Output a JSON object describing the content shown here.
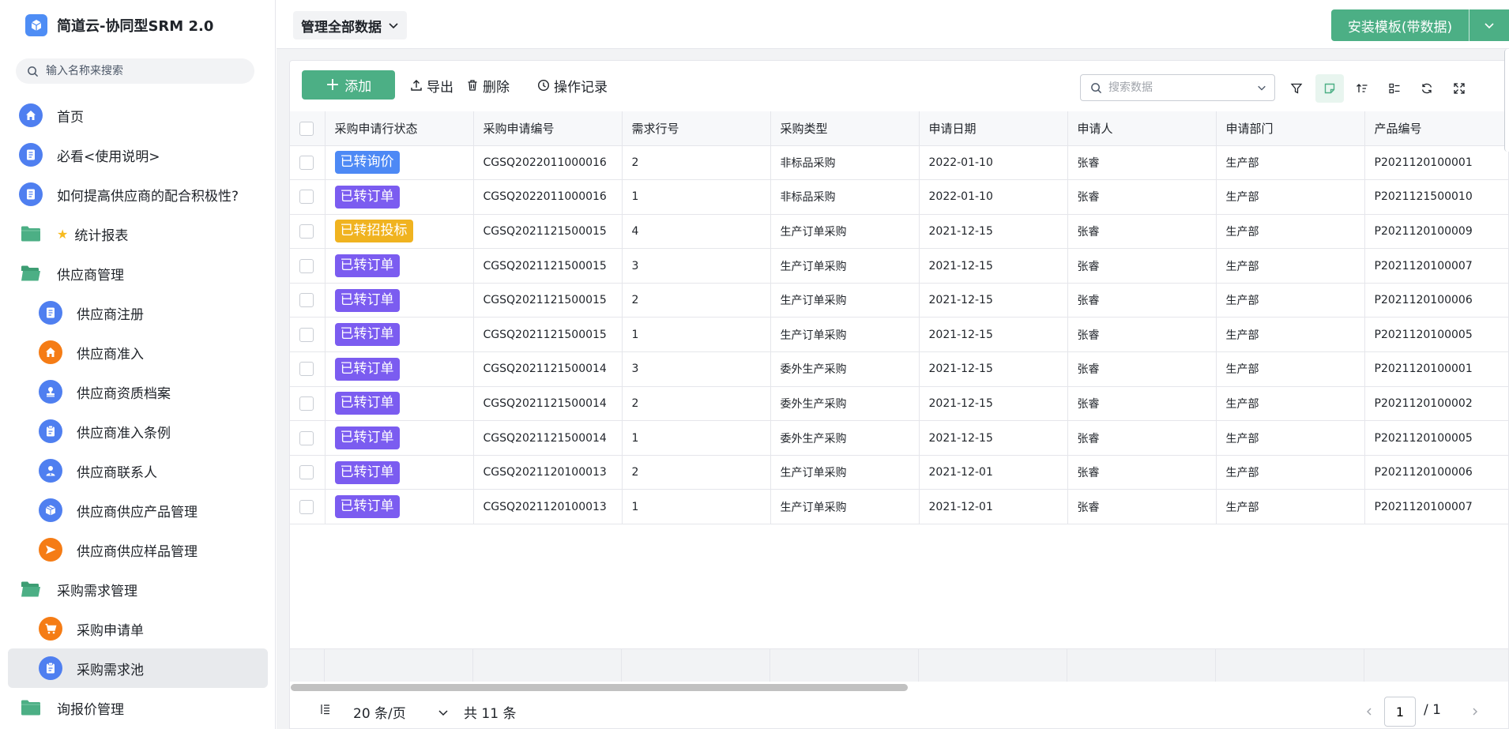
{
  "app": {
    "title": "简道云-协同型SRM 2.0"
  },
  "sidebar": {
    "search_placeholder": "输入名称来搜索",
    "items": [
      {
        "label": "首页",
        "icon": "home-icon",
        "level": 1,
        "color": "blue"
      },
      {
        "label": "必看<使用说明>",
        "icon": "document-icon",
        "level": 1,
        "color": "blue"
      },
      {
        "label": "如何提高供应商的配合积极性?",
        "icon": "document-icon",
        "level": 1,
        "color": "blue"
      },
      {
        "label": "统计报表",
        "icon": "folder-icon",
        "level": 1,
        "starred": true
      },
      {
        "label": "供应商管理",
        "icon": "folder-open-icon",
        "level": 1
      },
      {
        "label": "供应商注册",
        "icon": "document-icon",
        "level": 2,
        "color": "blue"
      },
      {
        "label": "供应商准入",
        "icon": "home-icon",
        "level": 2,
        "color": "orange"
      },
      {
        "label": "供应商资质档案",
        "icon": "stamp-icon",
        "level": 2,
        "color": "blue"
      },
      {
        "label": "供应商准入条例",
        "icon": "clipboard-icon",
        "level": 2,
        "color": "blue"
      },
      {
        "label": "供应商联系人",
        "icon": "user-icon",
        "level": 2,
        "color": "blue"
      },
      {
        "label": "供应商供应产品管理",
        "icon": "box-icon",
        "level": 2,
        "color": "blue"
      },
      {
        "label": "供应商供应样品管理",
        "icon": "send-icon",
        "level": 2,
        "color": "orange"
      },
      {
        "label": "采购需求管理",
        "icon": "folder-open-icon",
        "level": 1
      },
      {
        "label": "采购申请单",
        "icon": "cart-icon",
        "level": 2,
        "color": "orange"
      },
      {
        "label": "采购需求池",
        "icon": "clipboard-icon",
        "level": 2,
        "color": "blue",
        "active": true
      },
      {
        "label": "询报价管理",
        "icon": "folder-icon",
        "level": 1
      }
    ]
  },
  "topbar": {
    "scope_label": "管理全部数据",
    "install_label": "安装模板(带数据)"
  },
  "toolbar": {
    "add_label": "添加",
    "export_label": "导出",
    "delete_label": "删除",
    "log_label": "操作记录",
    "search_placeholder": "搜索数据"
  },
  "table": {
    "headers": [
      "采购申请行状态",
      "采购申请编号",
      "需求行号",
      "采购类型",
      "申请日期",
      "申请人",
      "申请部门",
      "产品编号"
    ],
    "rows": [
      {
        "status": "已转询价",
        "status_color": "blue",
        "code": "CGSQ2022011000016",
        "line": "2",
        "type": "非标品采购",
        "date": "2022-01-10",
        "applicant": "张睿",
        "dept": "生产部",
        "product": "P2021120100001"
      },
      {
        "status": "已转订单",
        "status_color": "purple",
        "code": "CGSQ2022011000016",
        "line": "1",
        "type": "非标品采购",
        "date": "2022-01-10",
        "applicant": "张睿",
        "dept": "生产部",
        "product": "P2021121500010"
      },
      {
        "status": "已转招投标",
        "status_color": "yellow",
        "code": "CGSQ2021121500015",
        "line": "4",
        "type": "生产订单采购",
        "date": "2021-12-15",
        "applicant": "张睿",
        "dept": "生产部",
        "product": "P2021120100009"
      },
      {
        "status": "已转订单",
        "status_color": "purple",
        "code": "CGSQ2021121500015",
        "line": "3",
        "type": "生产订单采购",
        "date": "2021-12-15",
        "applicant": "张睿",
        "dept": "生产部",
        "product": "P2021120100007"
      },
      {
        "status": "已转订单",
        "status_color": "purple",
        "code": "CGSQ2021121500015",
        "line": "2",
        "type": "生产订单采购",
        "date": "2021-12-15",
        "applicant": "张睿",
        "dept": "生产部",
        "product": "P2021120100006"
      },
      {
        "status": "已转订单",
        "status_color": "purple",
        "code": "CGSQ2021121500015",
        "line": "1",
        "type": "生产订单采购",
        "date": "2021-12-15",
        "applicant": "张睿",
        "dept": "生产部",
        "product": "P2021120100005"
      },
      {
        "status": "已转订单",
        "status_color": "purple",
        "code": "CGSQ2021121500014",
        "line": "3",
        "type": "委外生产采购",
        "date": "2021-12-15",
        "applicant": "张睿",
        "dept": "生产部",
        "product": "P2021120100001"
      },
      {
        "status": "已转订单",
        "status_color": "purple",
        "code": "CGSQ2021121500014",
        "line": "2",
        "type": "委外生产采购",
        "date": "2021-12-15",
        "applicant": "张睿",
        "dept": "生产部",
        "product": "P2021120100002"
      },
      {
        "status": "已转订单",
        "status_color": "purple",
        "code": "CGSQ2021121500014",
        "line": "1",
        "type": "委外生产采购",
        "date": "2021-12-15",
        "applicant": "张睿",
        "dept": "生产部",
        "product": "P2021120100005"
      },
      {
        "status": "已转订单",
        "status_color": "purple",
        "code": "CGSQ2021120100013",
        "line": "2",
        "type": "生产订单采购",
        "date": "2021-12-01",
        "applicant": "张睿",
        "dept": "生产部",
        "product": "P2021120100006"
      },
      {
        "status": "已转订单",
        "status_color": "purple",
        "code": "CGSQ2021120100013",
        "line": "1",
        "type": "生产订单采购",
        "date": "2021-12-01",
        "applicant": "张睿",
        "dept": "生产部",
        "product": "P2021120100007"
      }
    ]
  },
  "pager": {
    "page_size_label": "20 条/页",
    "total_label": "共 11 条",
    "current_page": "1",
    "total_pages_label": "/ 1"
  },
  "colors": {
    "accent": "#4caf85",
    "tag_blue": "#4d89f5",
    "tag_purple": "#7b5cf0",
    "tag_yellow": "#f0b320"
  }
}
